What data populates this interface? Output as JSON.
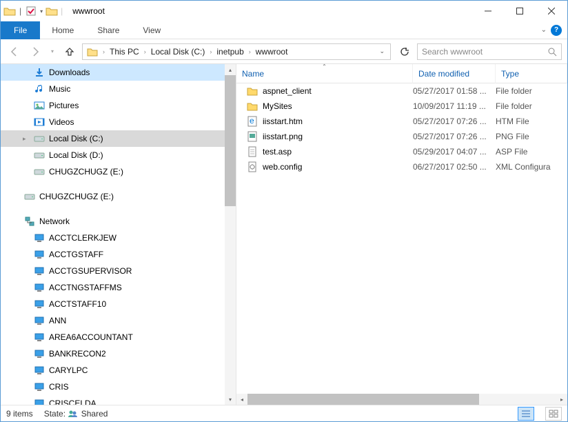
{
  "window": {
    "title": "wwwroot"
  },
  "ribbon": {
    "tabs": [
      "File",
      "Home",
      "Share",
      "View"
    ]
  },
  "address": {
    "segments": [
      "This PC",
      "Local Disk (C:)",
      "inetpub",
      "wwwroot"
    ],
    "search_placeholder": "Search wwwroot"
  },
  "tree": [
    {
      "label": "Downloads",
      "icon": "download",
      "depth": 1,
      "highlight": true,
      "expand": ""
    },
    {
      "label": "Music",
      "icon": "music",
      "depth": 1,
      "expand": ""
    },
    {
      "label": "Pictures",
      "icon": "pictures",
      "depth": 1,
      "expand": ""
    },
    {
      "label": "Videos",
      "icon": "videos",
      "depth": 1,
      "expand": ""
    },
    {
      "label": "Local Disk (C:)",
      "icon": "drive",
      "depth": 1,
      "selected": true,
      "expand": "▸"
    },
    {
      "label": "Local Disk (D:)",
      "icon": "drive",
      "depth": 1,
      "expand": ""
    },
    {
      "label": "CHUGZCHUGZ (E:)",
      "icon": "drive",
      "depth": 1,
      "expand": ""
    },
    {
      "label": "CHUGZCHUGZ (E:)",
      "icon": "drive",
      "depth": 0,
      "blank_before": true,
      "expand": ""
    },
    {
      "label": "Network",
      "icon": "network",
      "depth": 0,
      "blank_before": true,
      "expand": ""
    },
    {
      "label": "ACCTCLERKJEW",
      "icon": "computer",
      "depth": 1,
      "expand": ""
    },
    {
      "label": "ACCTGSTAFF",
      "icon": "computer",
      "depth": 1,
      "expand": ""
    },
    {
      "label": "ACCTGSUPERVISOR",
      "icon": "computer",
      "depth": 1,
      "expand": ""
    },
    {
      "label": "ACCTNGSTAFFMS",
      "icon": "computer",
      "depth": 1,
      "expand": ""
    },
    {
      "label": "ACCTSTAFF10",
      "icon": "computer",
      "depth": 1,
      "expand": ""
    },
    {
      "label": "ANN",
      "icon": "computer",
      "depth": 1,
      "expand": ""
    },
    {
      "label": "AREA6ACCOUNTANT",
      "icon": "computer",
      "depth": 1,
      "expand": ""
    },
    {
      "label": "BANKRECON2",
      "icon": "computer",
      "depth": 1,
      "expand": ""
    },
    {
      "label": "CARYLPC",
      "icon": "computer",
      "depth": 1,
      "expand": ""
    },
    {
      "label": "CRIS",
      "icon": "computer",
      "depth": 1,
      "expand": ""
    },
    {
      "label": "CRISCELDA",
      "icon": "computer",
      "depth": 1,
      "expand": ""
    }
  ],
  "columns": {
    "name": "Name",
    "date": "Date modified",
    "type": "Type"
  },
  "files": [
    {
      "name": "aspnet_client",
      "date": "05/27/2017 01:58 ...",
      "type": "File folder",
      "icon": "folder"
    },
    {
      "name": "MySites",
      "date": "10/09/2017 11:19 ...",
      "type": "File folder",
      "icon": "folder"
    },
    {
      "name": "iisstart.htm",
      "date": "05/27/2017 07:26 ...",
      "type": "HTM File",
      "icon": "htm"
    },
    {
      "name": "iisstart.png",
      "date": "05/27/2017 07:26 ...",
      "type": "PNG File",
      "icon": "png"
    },
    {
      "name": "test.asp",
      "date": "05/29/2017 04:07 ...",
      "type": "ASP File",
      "icon": "file"
    },
    {
      "name": "web.config",
      "date": "06/27/2017 02:50 ...",
      "type": "XML Configura",
      "icon": "config"
    }
  ],
  "status": {
    "items": "9 items",
    "state_label": "State:",
    "state_value": "Shared"
  }
}
